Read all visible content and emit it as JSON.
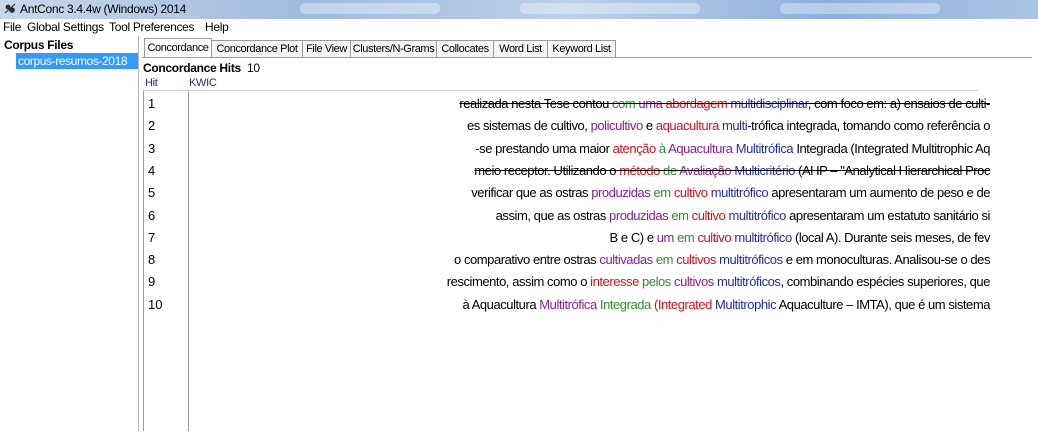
{
  "window": {
    "title": "AntConc 3.4.4w (Windows) 2014"
  },
  "menu": [
    "File",
    "Global Settings",
    "Tool Preferences",
    "Help"
  ],
  "corpus": {
    "header": "Corpus Files",
    "files": [
      "corpus-resumos-2018"
    ]
  },
  "tabs": [
    "Concordance",
    "Concordance Plot",
    "File View",
    "Clusters/N-Grams",
    "Collocates",
    "Word List",
    "Keyword List"
  ],
  "active_tab": "Concordance",
  "hits": {
    "label": "Concordance Hits",
    "count": "10"
  },
  "columns": {
    "hit": "Hit",
    "kwic": "KWIC"
  },
  "colors": {
    "red": "#c8141e",
    "green": "#2e8b2e",
    "purple": "#8a2090",
    "blue": "#2030a0",
    "selection": "#3399ff"
  },
  "rows": [
    {
      "hit": "1",
      "strike": true,
      "segments": [
        {
          "t": "realizada nesta Tese contou ",
          "c": "black"
        },
        {
          "t": "com ",
          "c": "green"
        },
        {
          "t": "uma ",
          "c": "purple"
        },
        {
          "t": "abordagem ",
          "c": "red"
        },
        {
          "t": "multidisciplinar",
          "c": "blue"
        },
        {
          "t": ", com foco em: a) ensaios de culti-",
          "c": "black"
        }
      ]
    },
    {
      "hit": "2",
      "strike": false,
      "segments": [
        {
          "t": "es sistemas de cultivo, ",
          "c": "black"
        },
        {
          "t": "policultivo ",
          "c": "purple"
        },
        {
          "t": "e ",
          "c": "black"
        },
        {
          "t": "aquacultura ",
          "c": "red"
        },
        {
          "t": "multi",
          "c": "blue"
        },
        {
          "t": "-trófica integrada, tomando como referência o",
          "c": "black"
        }
      ]
    },
    {
      "hit": "3",
      "strike": false,
      "segments": [
        {
          "t": "-se prestando uma maior ",
          "c": "black"
        },
        {
          "t": "atenção ",
          "c": "red"
        },
        {
          "t": "à ",
          "c": "green"
        },
        {
          "t": "Aquacultura ",
          "c": "purple"
        },
        {
          "t": "Multitrófica ",
          "c": "blue"
        },
        {
          "t": "Integrada (Integrated Multitrophic Aq",
          "c": "black"
        }
      ]
    },
    {
      "hit": "4",
      "strike": true,
      "segments": [
        {
          "t": "meio receptor. Utilizando o ",
          "c": "black"
        },
        {
          "t": "método ",
          "c": "red"
        },
        {
          "t": "de ",
          "c": "green"
        },
        {
          "t": "Avaliação ",
          "c": "purple"
        },
        {
          "t": "Multicritério ",
          "c": "blue"
        },
        {
          "t": "(AHP – \"Analytical Hierarchical Proc",
          "c": "black"
        }
      ]
    },
    {
      "hit": "5",
      "strike": false,
      "segments": [
        {
          "t": "verificar que as ostras ",
          "c": "black"
        },
        {
          "t": "produzidas ",
          "c": "purple"
        },
        {
          "t": "em ",
          "c": "green"
        },
        {
          "t": "cultivo ",
          "c": "red"
        },
        {
          "t": "multitrófico ",
          "c": "blue"
        },
        {
          "t": "apresentaram um aumento de peso e de",
          "c": "black"
        }
      ]
    },
    {
      "hit": "6",
      "strike": false,
      "segments": [
        {
          "t": "assim, que as ostras ",
          "c": "black"
        },
        {
          "t": "produzidas ",
          "c": "purple"
        },
        {
          "t": "em ",
          "c": "green"
        },
        {
          "t": "cultivo ",
          "c": "red"
        },
        {
          "t": "multitrófico ",
          "c": "blue"
        },
        {
          "t": "apresentaram um estatuto sanitário si",
          "c": "black"
        }
      ]
    },
    {
      "hit": "7",
      "strike": false,
      "segments": [
        {
          "t": "B e C) e ",
          "c": "black"
        },
        {
          "t": "um ",
          "c": "purple"
        },
        {
          "t": "em ",
          "c": "green"
        },
        {
          "t": "cultivo ",
          "c": "red"
        },
        {
          "t": "multitrófico ",
          "c": "blue"
        },
        {
          "t": "(local A). Durante seis meses, de fev",
          "c": "black"
        }
      ]
    },
    {
      "hit": "8",
      "strike": false,
      "segments": [
        {
          "t": "o comparativo entre ostras ",
          "c": "black"
        },
        {
          "t": "cultivadas ",
          "c": "purple"
        },
        {
          "t": "em ",
          "c": "green"
        },
        {
          "t": "cultivos ",
          "c": "red"
        },
        {
          "t": "multitróficos ",
          "c": "blue"
        },
        {
          "t": "e em monoculturas. Analisou-se o des",
          "c": "black"
        }
      ]
    },
    {
      "hit": "9",
      "strike": false,
      "segments": [
        {
          "t": "rescimento, assim como o ",
          "c": "black"
        },
        {
          "t": "interesse ",
          "c": "red"
        },
        {
          "t": "pelos ",
          "c": "green"
        },
        {
          "t": "cultivos ",
          "c": "purple"
        },
        {
          "t": "multitróficos",
          "c": "blue"
        },
        {
          "t": ", combinando espécies superiores, que",
          "c": "black"
        }
      ]
    },
    {
      "hit": "10",
      "strike": false,
      "segments": [
        {
          "t": "à Aquacultura ",
          "c": "black"
        },
        {
          "t": "Multitrófica ",
          "c": "purple"
        },
        {
          "t": "Integrada ",
          "c": "green"
        },
        {
          "t": "(Integrated ",
          "c": "red"
        },
        {
          "t": "Multitrophic ",
          "c": "blue"
        },
        {
          "t": "Aquaculture – IMTA), que é um sistema",
          "c": "black"
        }
      ]
    }
  ]
}
